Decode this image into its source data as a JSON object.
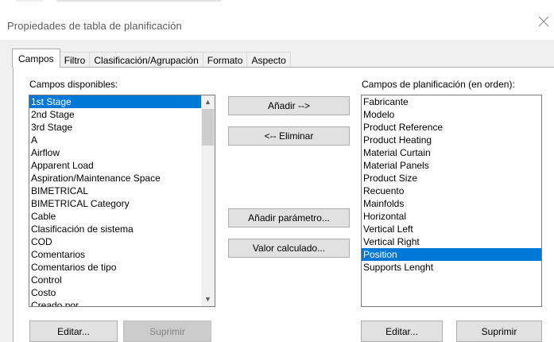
{
  "dialog": {
    "title": "Propiedades de tabla de planificación"
  },
  "tabs": [
    {
      "label": "Campos"
    },
    {
      "label": "Filtro"
    },
    {
      "label": "Clasificación/Agrupación"
    },
    {
      "label": "Formato"
    },
    {
      "label": "Aspecto"
    }
  ],
  "available": {
    "label": "Campos disponibles:",
    "items": [
      "1st Stage",
      "2nd Stage",
      "3rd Stage",
      "A",
      "Airflow",
      "Apparent Load",
      "Aspiration/Maintenance Space",
      "BIMETRICAL",
      "BIMETRICAL Category",
      "Cable",
      "Clasificación de sistema",
      "COD",
      "Comentarios",
      "Comentarios de tipo",
      "Control",
      "Costo",
      "Creado por"
    ],
    "selected_index": 0,
    "edit_button": "Editar...",
    "delete_button": "Suprimir"
  },
  "schedule": {
    "label": "Campos de planificación (en orden):",
    "items": [
      "Fabricante",
      "Modelo",
      "Product Reference",
      "Product Heating",
      "Material Curtain",
      "Material Panels",
      "Product Size",
      "Recuento",
      "Mainfolds",
      "Horizontal",
      "Vertical Left",
      "Vertical Right",
      "Position",
      "Supports Lenght"
    ],
    "selected_index": 12,
    "edit_button": "Editar...",
    "delete_button": "Suprimir"
  },
  "actions": {
    "add": "Añadir -->",
    "remove": "<-- Eliminar",
    "add_parameter": "Añadir parámetro...",
    "calculated_value": "Valor calculado..."
  },
  "colors": {
    "selection": "#0078d7",
    "button_face": "#e1e1e1",
    "dialog_bg": "#f0f0f0"
  }
}
